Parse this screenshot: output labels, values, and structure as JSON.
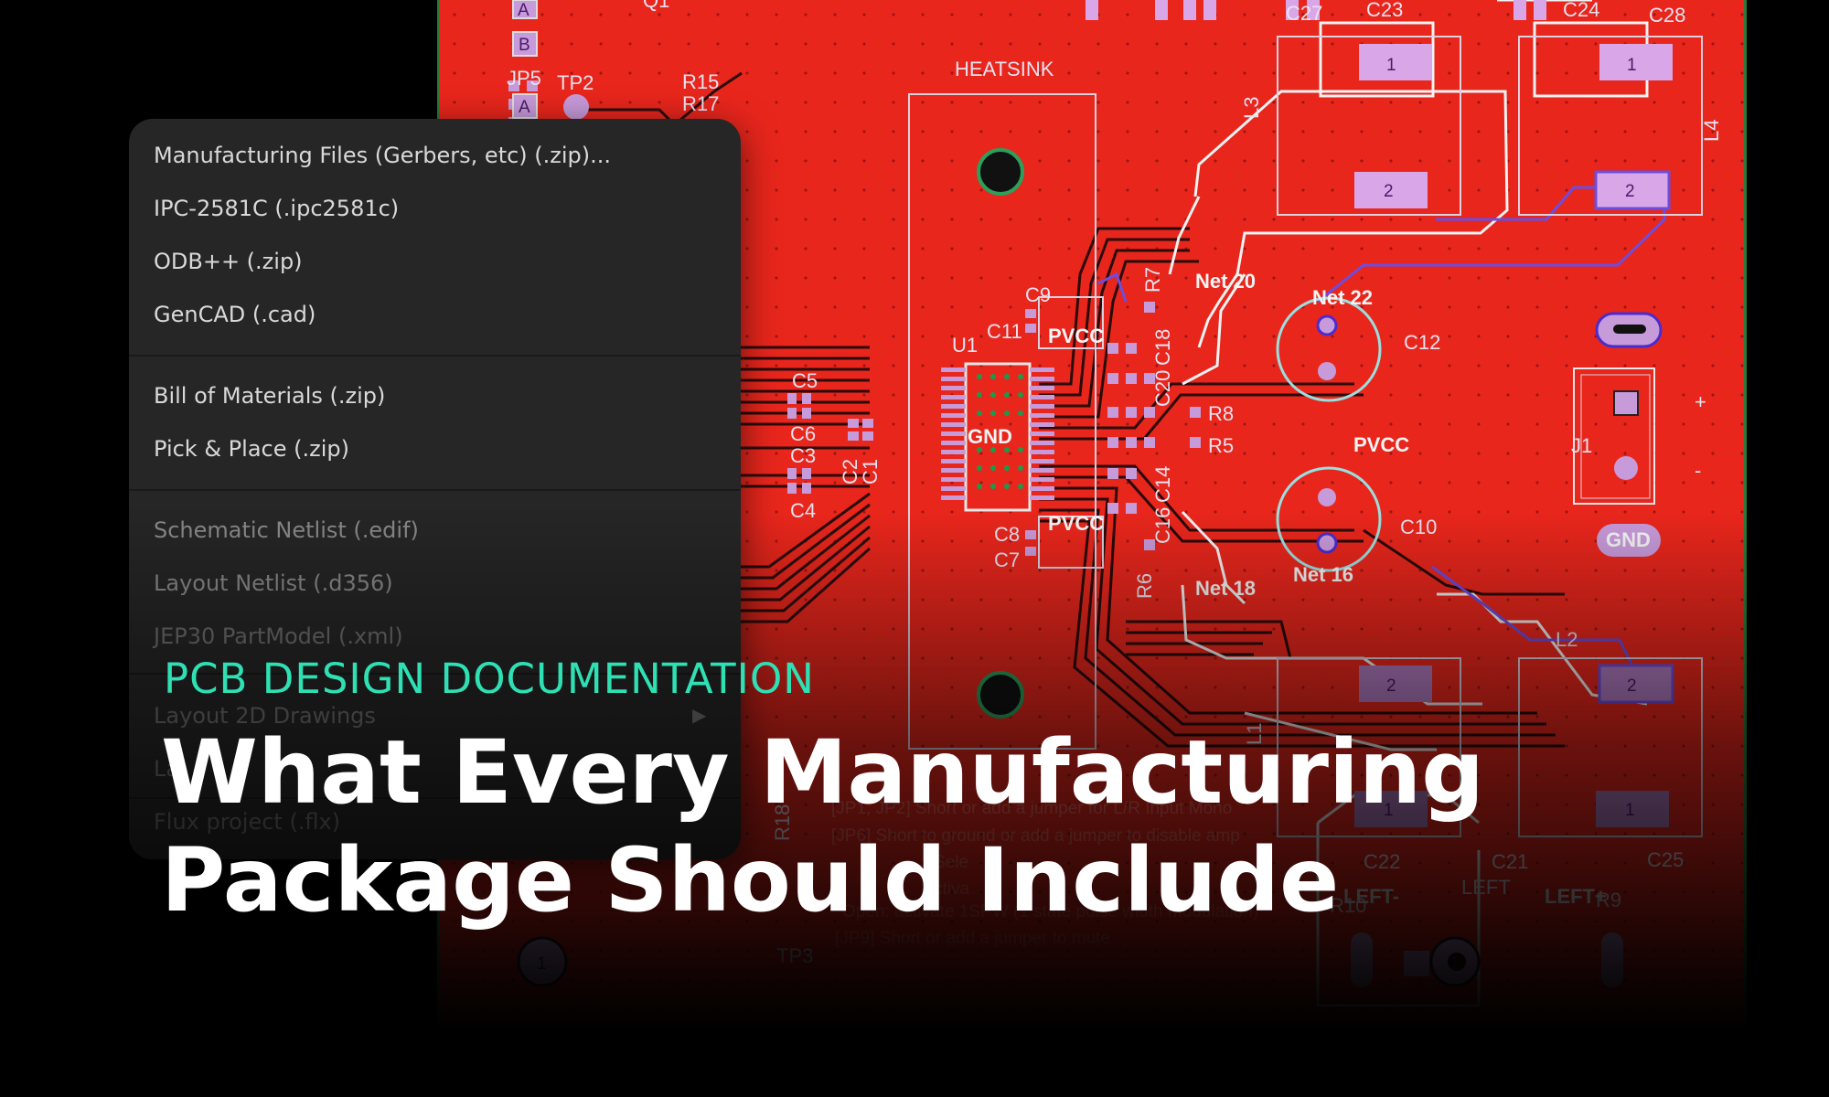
{
  "menu": {
    "items": [
      {
        "label": "Manufacturing Files (Gerbers, etc) (.zip)..."
      },
      {
        "label": "IPC-2581C (.ipc2581c)"
      },
      {
        "label": "ODB++ (.zip)"
      },
      {
        "label": "GenCAD (.cad)"
      },
      {
        "label": "Bill of Materials (.zip)"
      },
      {
        "label": "Pick & Place (.zip)"
      },
      {
        "label": "Schematic Netlist (.edif)"
      },
      {
        "label": "Layout Netlist (.d356)"
      },
      {
        "label": "JEP30 PartModel (.xml)"
      },
      {
        "label": "Layout 2D Drawings"
      },
      {
        "label": "La"
      },
      {
        "label": "Flux project (.flx)"
      }
    ]
  },
  "hero": {
    "eyebrow": "PCB DESIGN DOCUMENTATION",
    "headline_line1": "What Every Manufacturing",
    "headline_line2": "Package Should Include"
  },
  "pcb": {
    "refs": {
      "c27": "C27",
      "c23": "C23",
      "c24": "C24",
      "c28": "C28",
      "q1": "Q1",
      "jp5": "JP5",
      "tp2": "TP2",
      "r15": "R15",
      "r17": "R17",
      "heatsink": "HEATSINK",
      "l3": "L3",
      "l4": "L4",
      "c9": "C9",
      "r7": "R7",
      "net20": "Net 20",
      "net22": "Net 22",
      "c11": "C11",
      "pvcc_top": "PVCC",
      "c18": "C18",
      "c12": "C12",
      "u1": "U1",
      "c5": "C5",
      "c6": "C6",
      "c3": "C3",
      "c4": "C4",
      "c20": "C20",
      "r8": "R8",
      "gnd_u1": "GND",
      "r5": "R5",
      "pvcc_mid": "PVCC",
      "j1": "J1",
      "c2": "C2",
      "c1": "C1",
      "c14": "C14",
      "c8": "C8",
      "pvcc_bot": "PVCC",
      "c10": "C10",
      "c7": "C7",
      "c16": "C16",
      "net16": "Net 16",
      "gnd_pad": "GND",
      "r6": "R6",
      "net18": "Net 18",
      "l2": "L2",
      "l1": "L1",
      "c22": "C22",
      "c21": "C21",
      "c25": "C25",
      "left_minus": "LEFT-",
      "left_label": "LEFT",
      "left_plus": "LEFT+",
      "r10": "R10",
      "r9": "R9",
      "r18": "R18",
      "tp3": "TP3",
      "pin_a1": "A",
      "pin_b": "B",
      "pin_a2": "A",
      "pad2_a": "2",
      "pad2_b": "2",
      "pad1_a": "1",
      "pad1_b": "1",
      "pad2_c": "2",
      "pad2_d": "2",
      "pad1_c": "1",
      "pad1_d": "1",
      "hole1_a": "1",
      "hole1_b": "1",
      "plus": "+",
      "minus": "-"
    },
    "notes": {
      "line1": "[JP1, JP2] Short or add a jumper for L/R Input Mono",
      "line2": "[JP6] Short to ground or add a jumper to disable amp",
      "line3": "Sele",
      "line4": "ctiva",
      "line5": "Open: activate 1SPW (1 state pulse width modulation)",
      "line6": "[JP9] Short or add a jumper to mute"
    }
  },
  "colors": {
    "board": "#e8261c",
    "menu_bg": "#262626",
    "eyebrow": "#2ee0b3",
    "headline": "#ffffff"
  }
}
